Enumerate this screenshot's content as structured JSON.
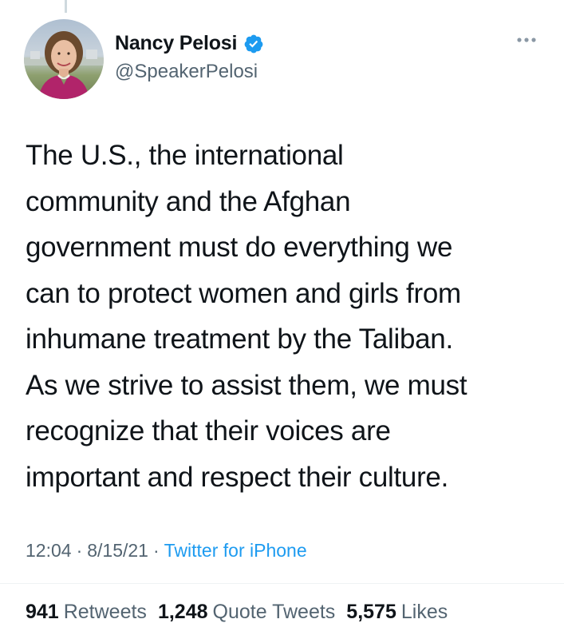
{
  "author": {
    "display_name": "Nancy Pelosi",
    "handle": "@SpeakerPelosi",
    "verified": true
  },
  "tweet": {
    "text": "The U.S., the international\ncommunity and the Afghan\ngovernment must do everything we\ncan to protect women and girls from\ninhumane treatment by the Taliban.\nAs we strive to assist them, we must\nrecognize that their voices are\nimportant and respect their culture.",
    "time": "12:04",
    "date": "8/15/21",
    "separator": "·",
    "source": "Twitter for iPhone"
  },
  "stats": {
    "retweets_count": "941",
    "retweets_label": "Retweets",
    "quotes_count": "1,248",
    "quotes_label": "Quote Tweets",
    "likes_count": "5,575",
    "likes_label": "Likes"
  },
  "icons": {
    "verified": "verified-badge-icon",
    "more": "more-options-icon"
  },
  "colors": {
    "text_primary": "#0f1419",
    "text_secondary": "#536471",
    "accent": "#1d9bf0"
  }
}
